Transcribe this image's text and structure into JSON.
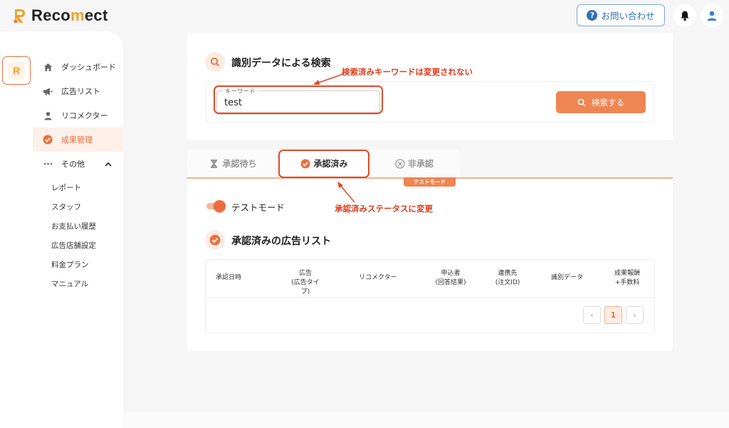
{
  "app": {
    "brand_prefix": "Reco",
    "brand_accent": "m",
    "brand_suffix": "ect",
    "brand_color": "#f0a02a",
    "accent_color": "#ef6d3c"
  },
  "header": {
    "contact_label": "お問い合わせ",
    "contact_icon": "question-circle-icon",
    "bell_icon": "bell-icon",
    "user_icon": "user-icon"
  },
  "sidebar": {
    "items": [
      {
        "label": "ダッシュボード",
        "icon": "home-icon"
      },
      {
        "label": "広告リスト",
        "icon": "megaphone-icon"
      },
      {
        "label": "リコメクター",
        "icon": "person-icon"
      },
      {
        "label": "成果管理",
        "icon": "check-circle-icon",
        "active": true
      },
      {
        "label": "その他",
        "icon": "more-icon",
        "expanded": true
      }
    ],
    "sub_items": [
      "レポート",
      "スタッフ",
      "お支払い履歴",
      "広告店舗設定",
      "料金プラン",
      "マニュアル"
    ]
  },
  "search": {
    "title": "識別データによる検索",
    "keyword_legend": "キーワード",
    "keyword_value": "test",
    "button_label": "検索する",
    "annotation": "検索済みキーワードは変更されない"
  },
  "tabs": {
    "pending": "承認待ち",
    "approved": "承認済み",
    "rejected": "非承認",
    "active": "approved",
    "test_badge": "テストモード",
    "annotation": "承認済みステータスに変更"
  },
  "list": {
    "toggle_label": "テストモード",
    "toggle_on": true,
    "title": "承認済みの広告リスト",
    "columns": [
      [
        "承認日時"
      ],
      [
        "広告",
        "(広告タイプ)"
      ],
      [
        "リコメクター"
      ],
      [
        "申込者",
        "(回答結果)"
      ],
      [
        "連携先",
        "(注文ID)"
      ],
      [
        "識別データ"
      ],
      [
        "成果報酬",
        "+手数料"
      ]
    ],
    "rows": [],
    "pagination": {
      "current": "1",
      "prev": "‹",
      "next": "›"
    }
  }
}
